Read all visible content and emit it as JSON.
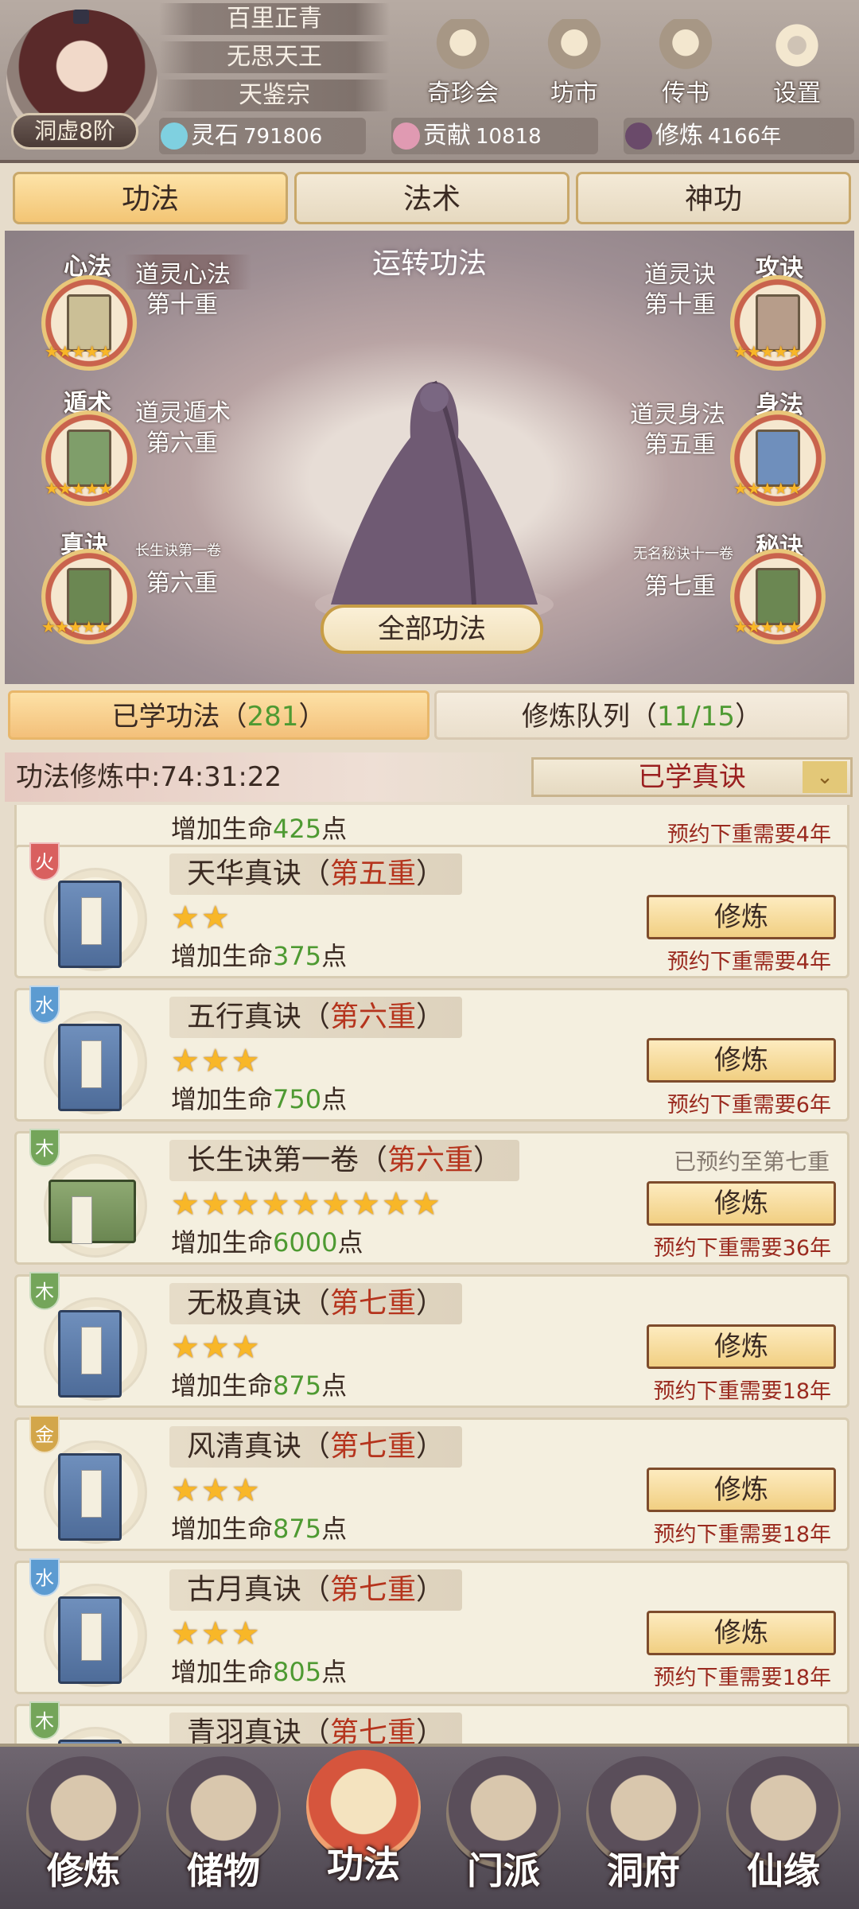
{
  "player": {
    "rank": "洞虚8阶",
    "titles": [
      "百里正青",
      "无思天王",
      "天鉴宗"
    ]
  },
  "header_buttons": [
    "奇珍会",
    "坊市",
    "传书",
    "设置"
  ],
  "resources": [
    {
      "label": "灵石",
      "value": "791806",
      "color": "#7fd0e0"
    },
    {
      "label": "贡献",
      "value": "10818",
      "color": "#e09ab2"
    },
    {
      "label": "修炼",
      "value": "4166年",
      "color": "#6a4a6a"
    }
  ],
  "main_tabs": [
    "功法",
    "法术",
    "神功"
  ],
  "scene": {
    "title": "运转功法",
    "all_button": "全部功法",
    "left_slots": [
      {
        "type": "心法",
        "name": "道灵心法",
        "level": "第十重",
        "stars": "★★★★★",
        "book_color": "#cbbf96"
      },
      {
        "type": "遁术",
        "name": "道灵遁术",
        "level": "第六重",
        "stars": "★★★★★",
        "book_color": "#7f9e6a"
      },
      {
        "type": "真诀",
        "name": "长生诀第一卷",
        "level": "第六重",
        "stars": "★★★★★",
        "book_color": "#6b8752"
      }
    ],
    "right_slots": [
      {
        "type": "攻诀",
        "name": "道灵诀",
        "level": "第十重",
        "stars": "★★★★★",
        "book_color": "#b79d8a"
      },
      {
        "type": "身法",
        "name": "道灵身法",
        "level": "第五重",
        "stars": "★★★★★",
        "book_color": "#6f8fbc"
      },
      {
        "type": "秘诀",
        "name": "无名秘诀十一卷",
        "level": "第七重",
        "stars": "★★★★★",
        "book_color": "#6b8752"
      }
    ]
  },
  "sub_tabs": {
    "learned_label": "已学功法（",
    "learned_count": "281",
    "learned_close": "）",
    "queue_label": "修炼队列（",
    "queue_count": "11/15",
    "queue_close": "）"
  },
  "status": {
    "text": "功法修炼中:74:31:22",
    "filter": "已学真诀",
    "chevron": "⌄"
  },
  "partial_top": {
    "effect_prefix": "增加生命",
    "effect_value": "425",
    "effect_suffix": "点",
    "note": "预约下重需要4年"
  },
  "cards": [
    {
      "element": "火",
      "element_color": "#d9605f",
      "name": "天华真诀（",
      "level": "第五重",
      "close": "）",
      "stars": "★★",
      "effect_prefix": "增加生命",
      "effect_value": "375",
      "effect_suffix": "点",
      "button": "修炼",
      "note": "预约下重需要4年",
      "book": "blue"
    },
    {
      "element": "水",
      "element_color": "#5c9bd1",
      "name": "五行真诀（",
      "level": "第六重",
      "close": "）",
      "stars": "★★★",
      "effect_prefix": "增加生命",
      "effect_value": "750",
      "effect_suffix": "点",
      "button": "修炼",
      "note": "预约下重需要6年",
      "book": "blue"
    },
    {
      "element": "木",
      "element_color": "#74a55a",
      "name": "长生诀第一卷（",
      "level": "第六重",
      "close": "）",
      "stars": "★★★★★★★★★",
      "effect_prefix": "增加生命",
      "effect_value": "6000",
      "effect_suffix": "点",
      "button": "修炼",
      "note": "预约下重需要36年",
      "reserve": "已预约至第七重",
      "book": "green"
    },
    {
      "element": "木",
      "element_color": "#74a55a",
      "name": "无极真诀（",
      "level": "第七重",
      "close": "）",
      "stars": "★★★",
      "effect_prefix": "增加生命",
      "effect_value": "875",
      "effect_suffix": "点",
      "button": "修炼",
      "note": "预约下重需要18年",
      "book": "blue"
    },
    {
      "element": "金",
      "element_color": "#d3a64a",
      "name": "风清真诀（",
      "level": "第七重",
      "close": "）",
      "stars": "★★★",
      "effect_prefix": "增加生命",
      "effect_value": "875",
      "effect_suffix": "点",
      "button": "修炼",
      "note": "预约下重需要18年",
      "book": "blue"
    },
    {
      "element": "水",
      "element_color": "#5c9bd1",
      "name": "古月真诀（",
      "level": "第七重",
      "close": "）",
      "stars": "★★★",
      "effect_prefix": "增加生命",
      "effect_value": "805",
      "effect_suffix": "点",
      "button": "修炼",
      "note": "预约下重需要18年",
      "book": "blue"
    },
    {
      "element": "木",
      "element_color": "#74a55a",
      "name": "青羽真诀（",
      "level": "第七重",
      "close": "）",
      "stars": "",
      "effect_prefix": "",
      "effect_value": "",
      "effect_suffix": "",
      "button": "",
      "note": "",
      "book": "blue"
    }
  ],
  "bottom_nav": [
    "修炼",
    "储物",
    "功法",
    "门派",
    "洞府",
    "仙缘"
  ],
  "colors": {
    "accent": "#f3c574",
    "level_red": "#b5341d",
    "value_green": "#4e9a32"
  }
}
